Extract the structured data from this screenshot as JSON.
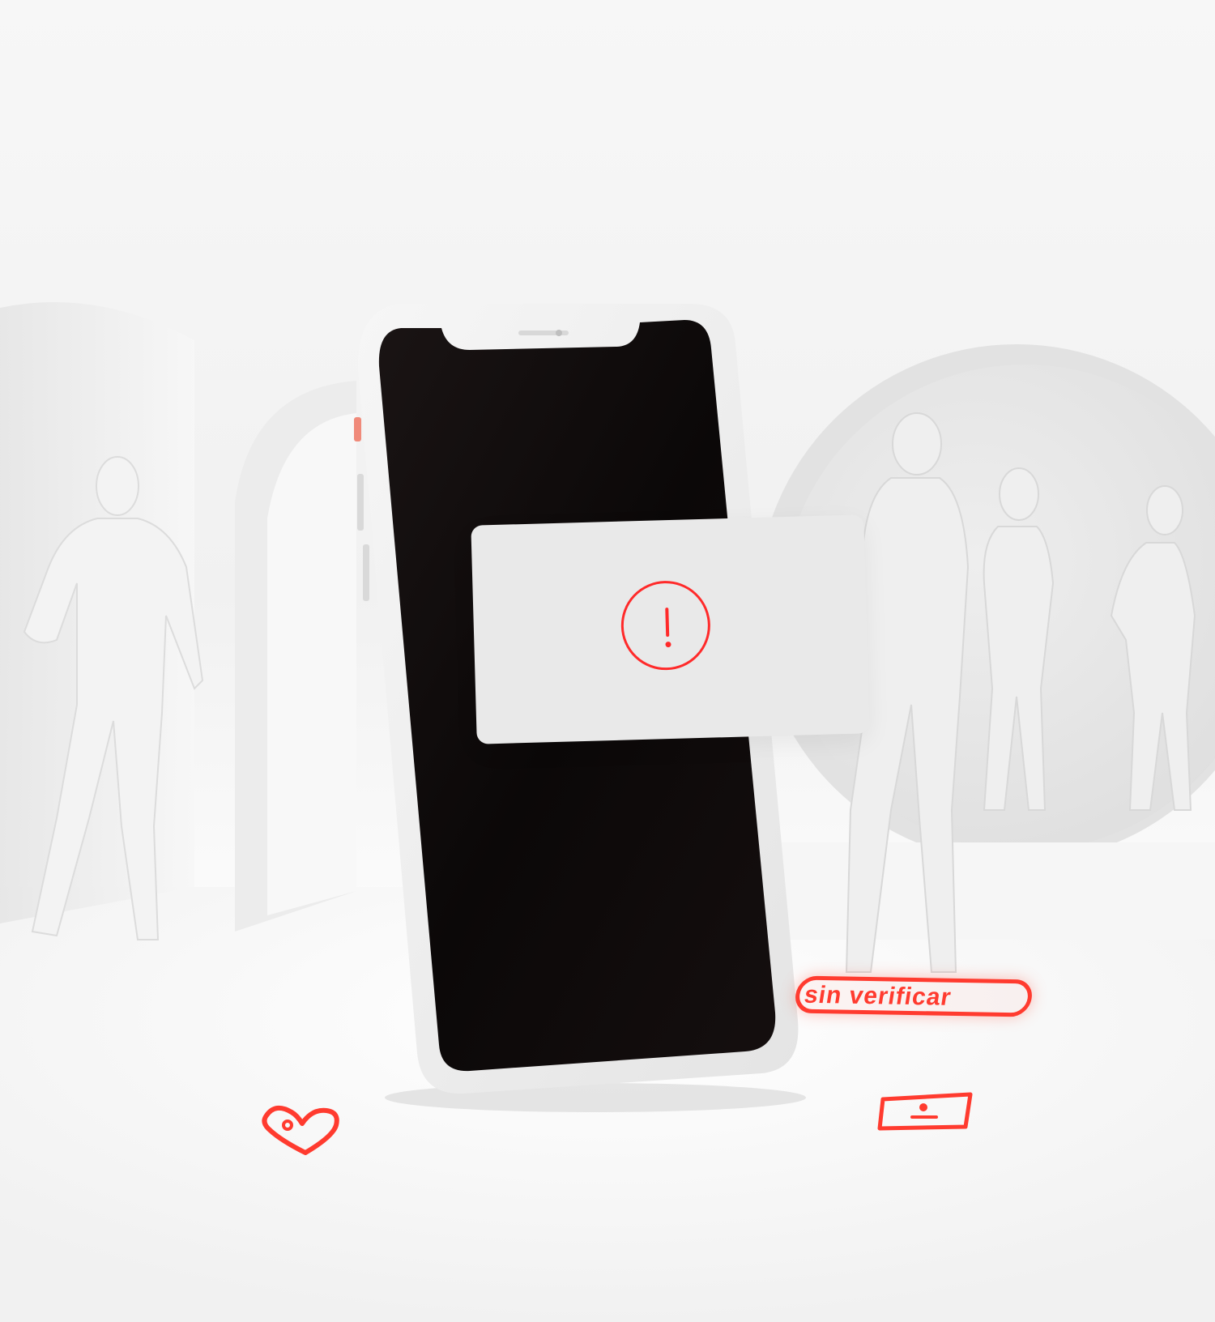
{
  "scene": {
    "floor_label": {
      "text": "sin verificar"
    },
    "alert_card": {
      "icon": "exclamation-icon"
    },
    "floor_icons": [
      {
        "name": "heart-icon"
      },
      {
        "name": "id-card-icon"
      }
    ],
    "colors": {
      "accent": "#ff3b2f",
      "background": "#f2f2f2",
      "phone_body": "#f0f0f0",
      "phone_screen": "#0a0707",
      "card": "#e8e8e8"
    }
  }
}
